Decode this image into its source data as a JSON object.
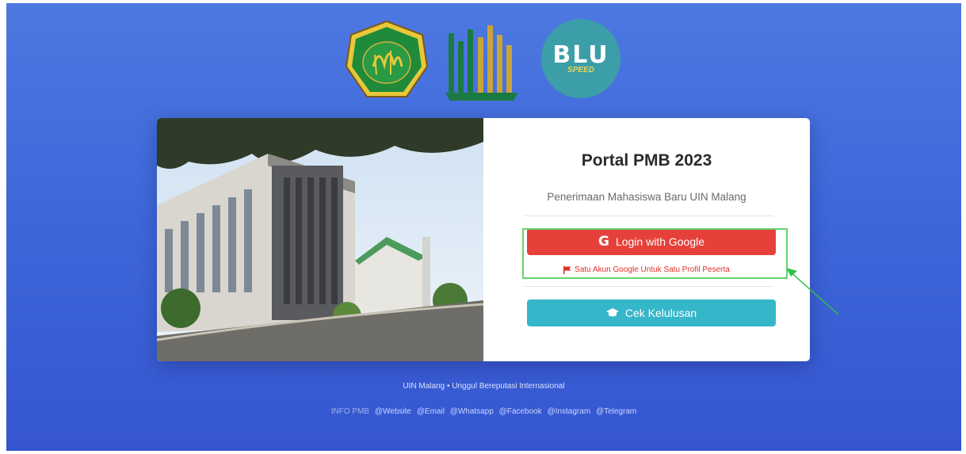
{
  "logos": {
    "blu_title": "BLU",
    "blu_sub": "SPEED"
  },
  "login": {
    "title": "Portal PMB 2023",
    "subtitle": "Penerimaan Mahasiswa Baru UIN Malang",
    "google_button": "Login with Google",
    "google_icon_glyph": "G",
    "notice": "Satu Akun Google Untuk Satu Profil Peserta",
    "cek_button": "Cek Kelulusan"
  },
  "footer": {
    "tagline": "UIN Malang • Unggul Bereputasi Internasional",
    "links": [
      "INFO PMB",
      "@Website",
      "@Email",
      "@Whatsapp",
      "@Facebook",
      "@Instagram",
      "@Telegram"
    ]
  },
  "colors": {
    "background": "#3f68da",
    "google_button": "#e5413a",
    "cek_button": "#36b6c9",
    "highlight": "#66d36e"
  },
  "icons": [
    "google-g-icon",
    "flag-icon",
    "graduation-cap-icon",
    "arrow-icon"
  ]
}
